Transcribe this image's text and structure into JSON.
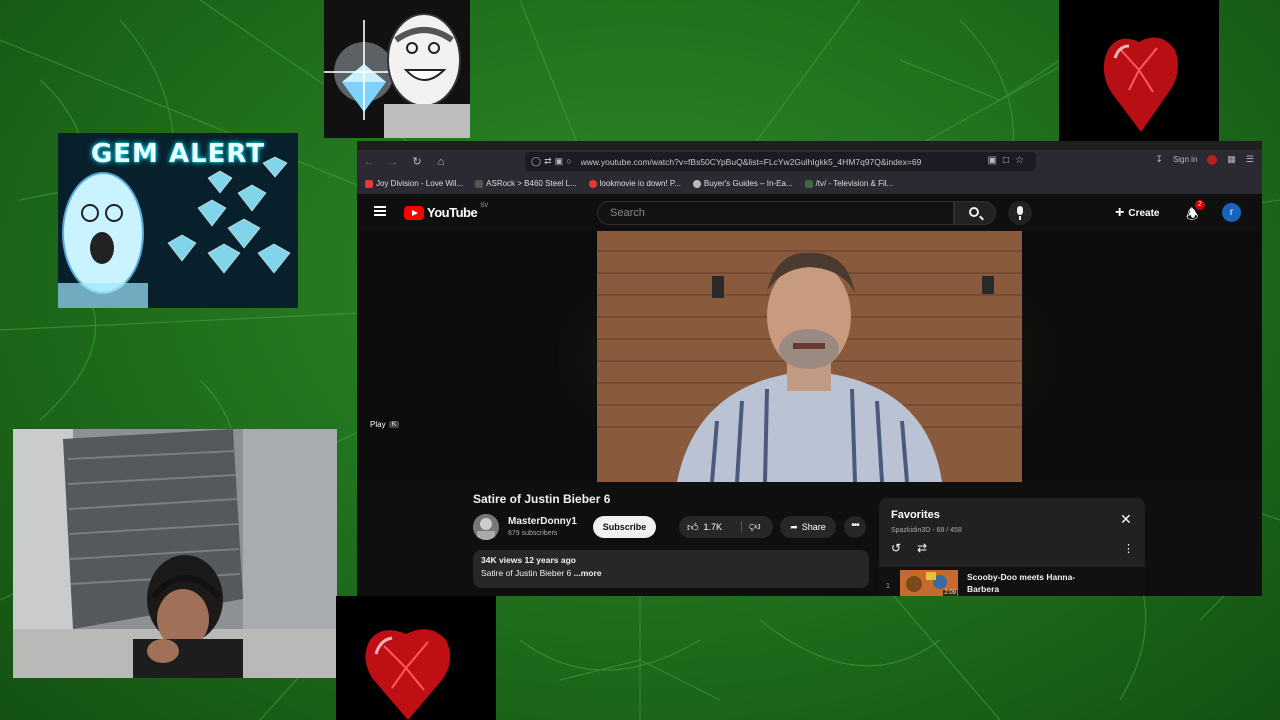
{
  "overlays": {
    "gem_alert_text": "GEM ALERT"
  },
  "browser": {
    "url": "www.youtube.com/watch?v=fBs50CYpBuQ&list=FLcYw2GulhIgkk5_4HM7q97Q&index=69",
    "sign_in": "Sign in",
    "bookmarks": [
      {
        "label": "Joy Division - Love Wil...",
        "color": "#e53935"
      },
      {
        "label": "ASRock > B460 Steel L...",
        "color": "#555555"
      },
      {
        "label": "lookmovie io down! P...",
        "color": "#e53935"
      },
      {
        "label": "Buyer's Guides – In-Ea...",
        "color": "#bbbbbb"
      },
      {
        "label": "/tv/ - Television & Fil...",
        "color": "#3a6b3a"
      }
    ]
  },
  "youtube": {
    "logo_text": "YouTube",
    "logo_country": "SV",
    "search_placeholder": "Search",
    "create_label": "Create",
    "notification_count": "2",
    "avatar_letter": "r",
    "play_tooltip": "Play",
    "play_shortcut": "K",
    "video": {
      "title": "Satire of Justin Bieber 6",
      "channel": "MasterDonny1",
      "subscribers": "879 subscribers",
      "subscribe_label": "Subscribe",
      "likes": "1.7K",
      "share_label": "Share",
      "views_date": "34K views  12 years ago",
      "description": "Satire of Justin Bieber 6",
      "more_label": "...more"
    },
    "playlist": {
      "title": "Favorites",
      "subtitle": "Spazkidin3D - 68 / 458",
      "item_index": "1",
      "item_title": "Scooby-Doo meets Hanna-Barbera",
      "item_duration": "2:09"
    }
  },
  "colors": {
    "background_green": "#1f6d1c",
    "youtube_red": "#ff0000",
    "yt_dark": "#0f0f0f"
  }
}
